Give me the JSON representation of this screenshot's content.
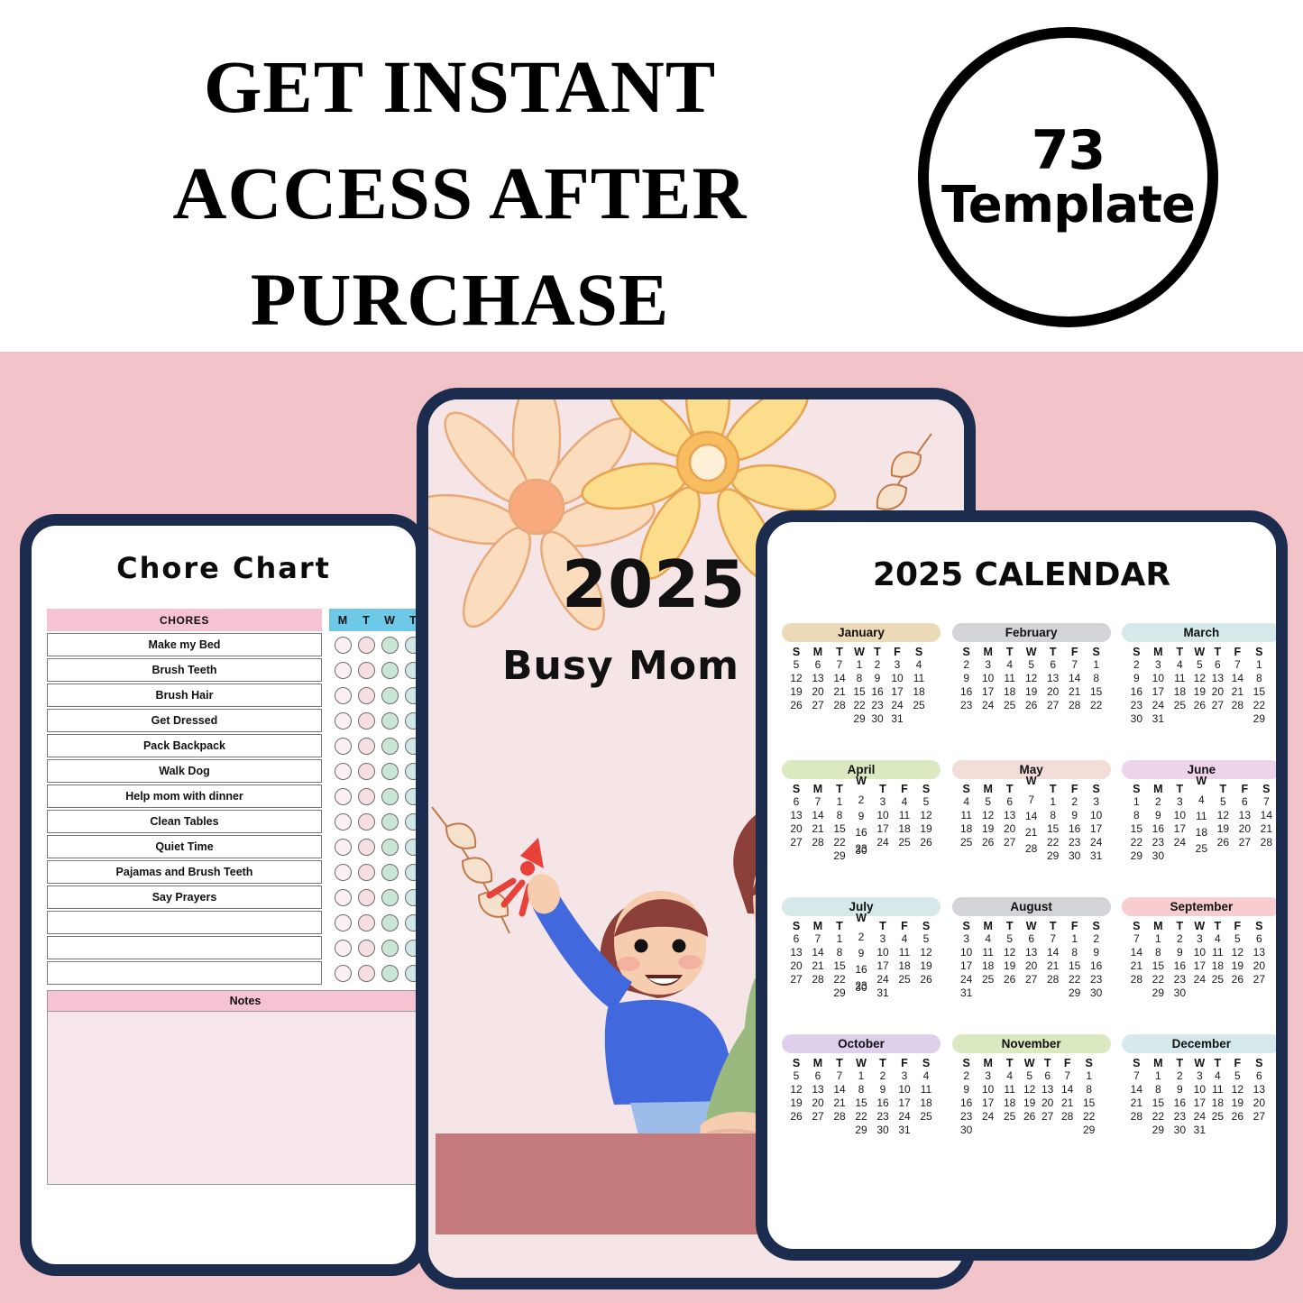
{
  "banner": {
    "headline": "GET INSTANT\nACCESS AFTER\nPURCHASE",
    "badge_count": "73",
    "badge_label": "Template"
  },
  "colors": {
    "stage_background": "#f2c3c8",
    "device_frame": "#1b2c4f",
    "cover_background": "#f5e5e6",
    "cover_bar": "#c4797a",
    "chores_header": "#f6c3d2",
    "days_header": "#6ec8e8",
    "notes_fill": "#f7e7ec"
  },
  "chore_chart": {
    "title": "Chore Chart",
    "chores_header": "CHORES",
    "chores": [
      "Make my Bed",
      "Brush Teeth",
      "Brush Hair",
      "Get Dressed",
      "Pack Backpack",
      "Walk Dog",
      "Help mom with dinner",
      "Clean Tables",
      "Quiet Time",
      "Pajamas and Brush Teeth",
      "Say Prayers",
      "",
      "",
      ""
    ],
    "day_headers": [
      "M",
      "T",
      "W",
      "T"
    ],
    "day_dot_colors": [
      "#fbf0f1",
      "#f7dee0",
      "#c8e6d3",
      "#cfe7e6"
    ],
    "notes_header": "Notes",
    "notes_value": ""
  },
  "cover": {
    "year": "2025",
    "subtitle": "Busy Mom Planner",
    "illustration": "mom-holding-child-on-phone"
  },
  "calendar": {
    "title": "2025 CALENDAR",
    "weekday_headers": [
      "S",
      "M",
      "T",
      "W",
      "T",
      "F",
      "S"
    ],
    "months": [
      {
        "name": "January",
        "color": "#ecd9b8",
        "style": "tight",
        "weeks": [
          [
            "5",
            "6",
            "7",
            "1",
            "2",
            "3",
            "4"
          ],
          [
            "12",
            "13",
            "14",
            "8",
            "9",
            "10",
            "11"
          ],
          [
            "19",
            "20",
            "21",
            "15",
            "16",
            "17",
            "18"
          ],
          [
            "26",
            "27",
            "28",
            "22",
            "23",
            "24",
            "25"
          ],
          [
            "",
            "",
            "",
            "29",
            "30",
            "31",
            ""
          ]
        ]
      },
      {
        "name": "February",
        "color": "#d2d4d8",
        "style": "plain",
        "weeks": [
          [
            "2",
            "3",
            "4",
            "5",
            "6",
            "7",
            "1"
          ],
          [
            "9",
            "10",
            "11",
            "12",
            "13",
            "14",
            "8"
          ],
          [
            "16",
            "17",
            "18",
            "19",
            "20",
            "21",
            "15"
          ],
          [
            "23",
            "24",
            "25",
            "26",
            "27",
            "28",
            "22"
          ]
        ]
      },
      {
        "name": "March",
        "color": "#d6e9ea",
        "style": "tight",
        "weeks": [
          [
            "2",
            "3",
            "4",
            "5",
            "6",
            "7",
            "1"
          ],
          [
            "9",
            "10",
            "11",
            "12",
            "13",
            "14",
            "8"
          ],
          [
            "16",
            "17",
            "18",
            "19",
            "20",
            "21",
            "15"
          ],
          [
            "23",
            "24",
            "25",
            "26",
            "27",
            "28",
            "22"
          ],
          [
            "30",
            "31",
            "",
            "",
            "",
            "",
            "29"
          ]
        ]
      },
      {
        "name": "April",
        "color": "#dbe9c0",
        "style": "wshift",
        "weeks": [
          [
            "6",
            "7",
            "1",
            "2",
            "3",
            "4",
            "5"
          ],
          [
            "13",
            "14",
            "8",
            "9",
            "10",
            "11",
            "12"
          ],
          [
            "20",
            "21",
            "15",
            "16",
            "17",
            "18",
            "19"
          ],
          [
            "27",
            "28",
            "22",
            "23",
            "24",
            "25",
            "26"
          ],
          [
            "",
            "",
            "29",
            "30",
            "",
            "",
            ""
          ]
        ]
      },
      {
        "name": "May",
        "color": "#f3ddd9",
        "style": "wshift",
        "weeks": [
          [
            "4",
            "5",
            "6",
            "7",
            "1",
            "2",
            "3"
          ],
          [
            "11",
            "12",
            "13",
            "14",
            "8",
            "9",
            "10"
          ],
          [
            "18",
            "19",
            "20",
            "21",
            "15",
            "16",
            "17"
          ],
          [
            "25",
            "26",
            "27",
            "28",
            "22",
            "23",
            "24"
          ],
          [
            "",
            "",
            "",
            "",
            "29",
            "30",
            "31"
          ]
        ]
      },
      {
        "name": "June",
        "color": "#eed4ea",
        "style": "wshift",
        "weeks": [
          [
            "1",
            "2",
            "3",
            "4",
            "5",
            "6",
            "7"
          ],
          [
            "8",
            "9",
            "10",
            "11",
            "12",
            "13",
            "14"
          ],
          [
            "15",
            "16",
            "17",
            "18",
            "19",
            "20",
            "21"
          ],
          [
            "22",
            "23",
            "24",
            "25",
            "26",
            "27",
            "28"
          ],
          [
            "29",
            "30",
            "",
            "",
            "",
            "",
            ""
          ]
        ]
      },
      {
        "name": "July",
        "color": "#d6e9ea",
        "style": "wshift",
        "weeks": [
          [
            "6",
            "7",
            "1",
            "2",
            "3",
            "4",
            "5"
          ],
          [
            "13",
            "14",
            "8",
            "9",
            "10",
            "11",
            "12"
          ],
          [
            "20",
            "21",
            "15",
            "16",
            "17",
            "18",
            "19"
          ],
          [
            "27",
            "28",
            "22",
            "23",
            "24",
            "25",
            "26"
          ],
          [
            "",
            "",
            "29",
            "30",
            "31",
            "",
            ""
          ]
        ]
      },
      {
        "name": "August",
        "color": "#d2d4d8",
        "style": "plain",
        "weeks": [
          [
            "3",
            "4",
            "5",
            "6",
            "7",
            "1",
            "2"
          ],
          [
            "10",
            "11",
            "12",
            "13",
            "14",
            "8",
            "9"
          ],
          [
            "17",
            "18",
            "19",
            "20",
            "21",
            "15",
            "16"
          ],
          [
            "24",
            "25",
            "26",
            "27",
            "28",
            "22",
            "23"
          ],
          [
            "31",
            "",
            "",
            "",
            "",
            "29",
            "30"
          ]
        ]
      },
      {
        "name": "September",
        "color": "#f7cdd0",
        "style": "tight",
        "weeks": [
          [
            "7",
            "1",
            "2",
            "3",
            "4",
            "5",
            "6"
          ],
          [
            "14",
            "8",
            "9",
            "10",
            "11",
            "12",
            "13"
          ],
          [
            "21",
            "15",
            "16",
            "17",
            "18",
            "19",
            "20"
          ],
          [
            "28",
            "22",
            "23",
            "24",
            "25",
            "26",
            "27"
          ],
          [
            "",
            "29",
            "30",
            "",
            "",
            "",
            ""
          ]
        ]
      },
      {
        "name": "October",
        "color": "#ded0ec",
        "style": "plain",
        "weeks": [
          [
            "5",
            "6",
            "7",
            "1",
            "2",
            "3",
            "4"
          ],
          [
            "12",
            "13",
            "14",
            "8",
            "9",
            "10",
            "11"
          ],
          [
            "19",
            "20",
            "21",
            "15",
            "16",
            "17",
            "18"
          ],
          [
            "26",
            "27",
            "28",
            "22",
            "23",
            "24",
            "25"
          ],
          [
            "",
            "",
            "",
            "29",
            "30",
            "31",
            ""
          ]
        ]
      },
      {
        "name": "November",
        "color": "#dbe9c0",
        "style": "tight",
        "weeks": [
          [
            "2",
            "3",
            "4",
            "5",
            "6",
            "7",
            "1"
          ],
          [
            "9",
            "10",
            "11",
            "12",
            "13",
            "14",
            "8"
          ],
          [
            "16",
            "17",
            "18",
            "19",
            "20",
            "21",
            "15"
          ],
          [
            "23",
            "24",
            "25",
            "26",
            "27",
            "28",
            "22"
          ],
          [
            "30",
            "",
            "",
            "",
            "",
            "",
            "29"
          ]
        ]
      },
      {
        "name": "December",
        "color": "#d6e9ea",
        "style": "tight",
        "weeks": [
          [
            "7",
            "1",
            "2",
            "3",
            "4",
            "5",
            "6"
          ],
          [
            "14",
            "8",
            "9",
            "10",
            "11",
            "12",
            "13"
          ],
          [
            "21",
            "15",
            "16",
            "17",
            "18",
            "19",
            "20"
          ],
          [
            "28",
            "22",
            "23",
            "24",
            "25",
            "26",
            "27"
          ],
          [
            "",
            "29",
            "30",
            "31",
            "",
            "",
            ""
          ]
        ]
      }
    ]
  }
}
